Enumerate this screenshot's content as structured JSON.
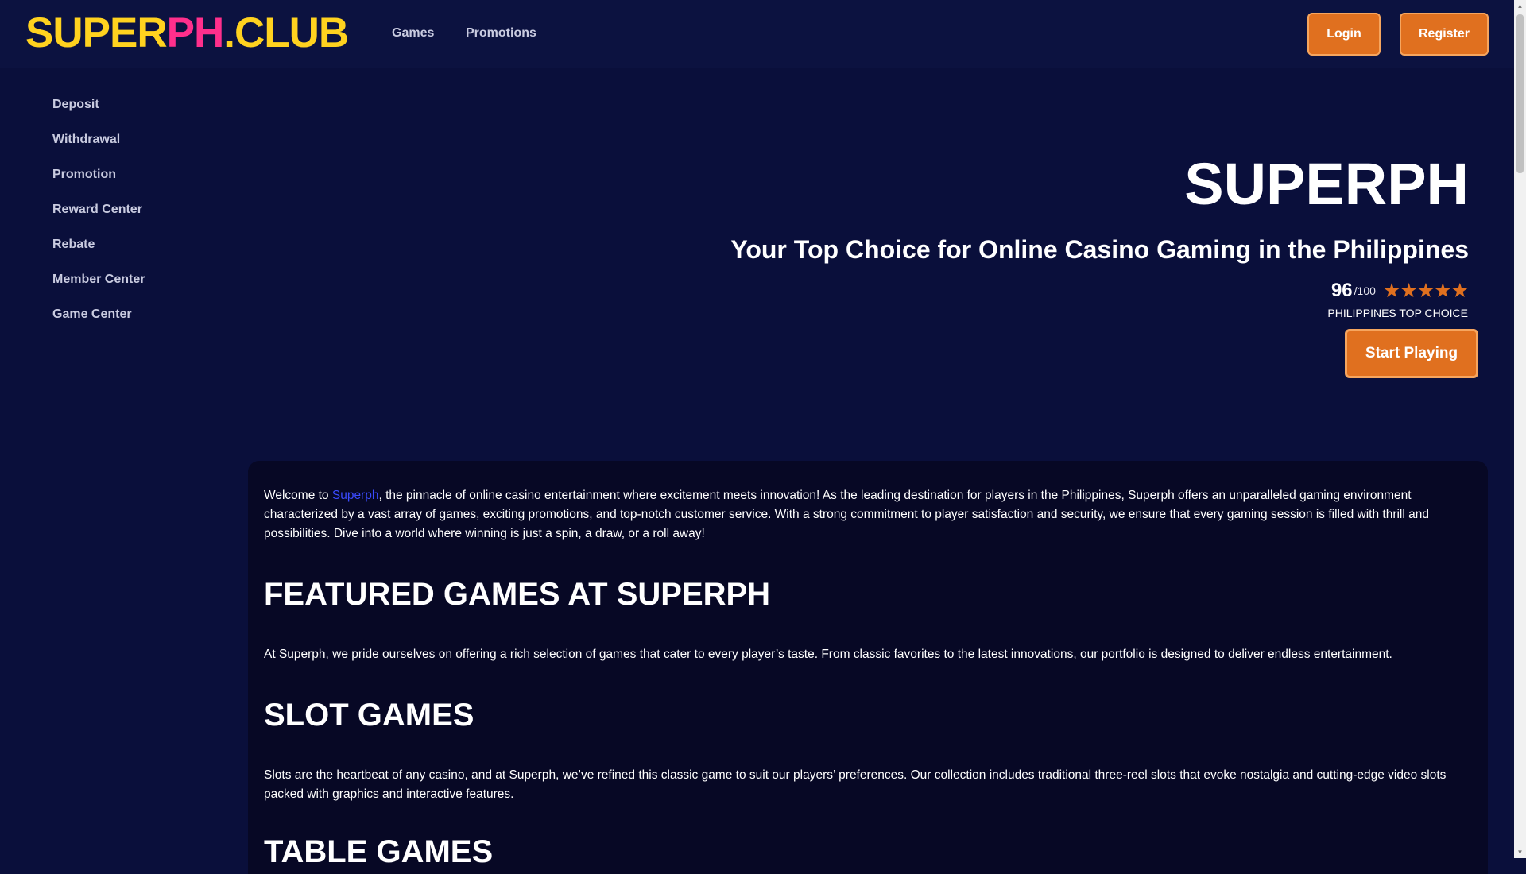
{
  "header": {
    "logo": {
      "part1": "SUPER",
      "part2": "PH",
      "part3": ".CLUB"
    },
    "nav": [
      {
        "label": "Games"
      },
      {
        "label": "Promotions"
      }
    ],
    "login_label": "Login",
    "register_label": "Register"
  },
  "sidebar": {
    "items": [
      {
        "label": "Deposit"
      },
      {
        "label": "Withdrawal"
      },
      {
        "label": "Promotion"
      },
      {
        "label": "Reward Center"
      },
      {
        "label": "Rebate"
      },
      {
        "label": "Member Center"
      },
      {
        "label": "Game Center"
      }
    ]
  },
  "hero": {
    "title": "SUPERPH",
    "subtitle": "Your Top Choice for Online Casino Gaming in the Philippines",
    "score": "96",
    "score_max": "/100",
    "stars": 5,
    "rating_label": "PHILIPPINES TOP CHOICE",
    "cta_label": "Start Playing"
  },
  "content": {
    "intro_prefix": "Welcome to ",
    "intro_link": "Superph",
    "intro_rest": ", the pinnacle of online casino entertainment where excitement meets innovation! As the leading destination for players in the Philippines, Superph offers an unparalleled gaming environment characterized by a vast array of games, exciting promotions, and top-notch customer service. With a strong commitment to player satisfaction and security, we ensure that every gaming session is filled with thrill and possibilities. Dive into a world where winning is just a spin, a draw, or a roll away!",
    "featured_heading": "FEATURED GAMES AT SUPERPH",
    "featured_text": "At Superph, we pride ourselves on offering a rich selection of games that cater to every player’s taste. From classic favorites to the latest innovations, our portfolio is designed to deliver endless entertainment.",
    "slot_heading": "SLOT GAMES",
    "slot_text": "Slots are the heartbeat of any casino, and at Superph, we’ve refined this classic game to suit our players’ preferences. Our collection includes traditional three-reel slots that evoke nostalgia and cutting-edge video slots packed with graphics and interactive features.",
    "table_heading": "TABLE GAMES"
  },
  "colors": {
    "background": "#0a0f3b",
    "accent": "#e0701f",
    "logo_yellow": "#ffd21f",
    "logo_pink": "#ff2f8c",
    "link": "#3b4bff"
  }
}
